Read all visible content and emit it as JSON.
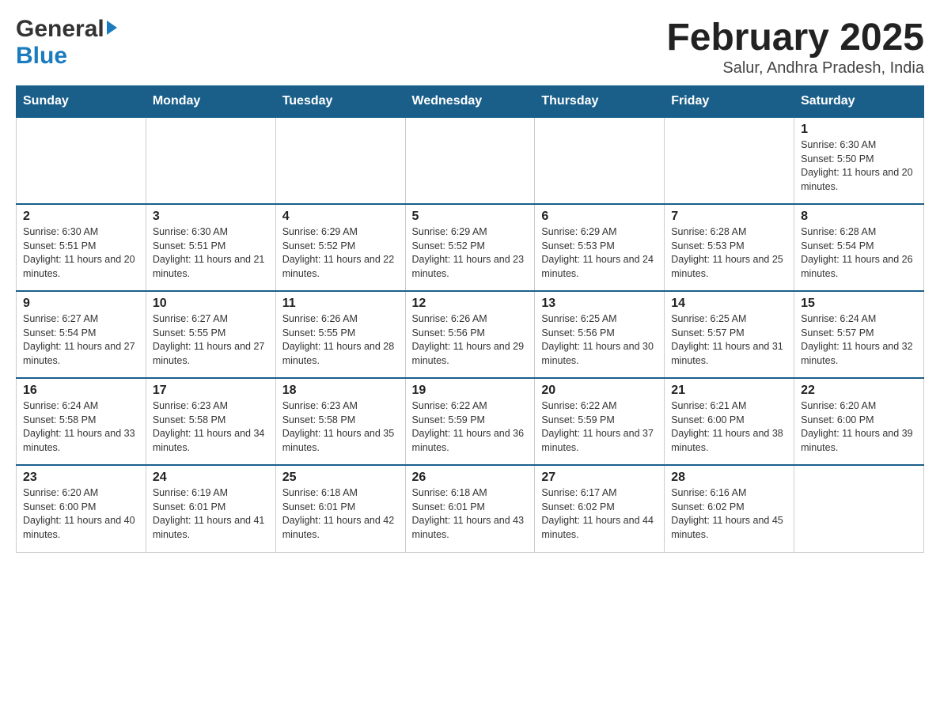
{
  "header": {
    "logo_general": "General",
    "logo_blue": "Blue",
    "month_title": "February 2025",
    "location": "Salur, Andhra Pradesh, India"
  },
  "days_of_week": [
    "Sunday",
    "Monday",
    "Tuesday",
    "Wednesday",
    "Thursday",
    "Friday",
    "Saturday"
  ],
  "weeks": [
    [
      {
        "day": "",
        "info": ""
      },
      {
        "day": "",
        "info": ""
      },
      {
        "day": "",
        "info": ""
      },
      {
        "day": "",
        "info": ""
      },
      {
        "day": "",
        "info": ""
      },
      {
        "day": "",
        "info": ""
      },
      {
        "day": "1",
        "info": "Sunrise: 6:30 AM\nSunset: 5:50 PM\nDaylight: 11 hours and 20 minutes."
      }
    ],
    [
      {
        "day": "2",
        "info": "Sunrise: 6:30 AM\nSunset: 5:51 PM\nDaylight: 11 hours and 20 minutes."
      },
      {
        "day": "3",
        "info": "Sunrise: 6:30 AM\nSunset: 5:51 PM\nDaylight: 11 hours and 21 minutes."
      },
      {
        "day": "4",
        "info": "Sunrise: 6:29 AM\nSunset: 5:52 PM\nDaylight: 11 hours and 22 minutes."
      },
      {
        "day": "5",
        "info": "Sunrise: 6:29 AM\nSunset: 5:52 PM\nDaylight: 11 hours and 23 minutes."
      },
      {
        "day": "6",
        "info": "Sunrise: 6:29 AM\nSunset: 5:53 PM\nDaylight: 11 hours and 24 minutes."
      },
      {
        "day": "7",
        "info": "Sunrise: 6:28 AM\nSunset: 5:53 PM\nDaylight: 11 hours and 25 minutes."
      },
      {
        "day": "8",
        "info": "Sunrise: 6:28 AM\nSunset: 5:54 PM\nDaylight: 11 hours and 26 minutes."
      }
    ],
    [
      {
        "day": "9",
        "info": "Sunrise: 6:27 AM\nSunset: 5:54 PM\nDaylight: 11 hours and 27 minutes."
      },
      {
        "day": "10",
        "info": "Sunrise: 6:27 AM\nSunset: 5:55 PM\nDaylight: 11 hours and 27 minutes."
      },
      {
        "day": "11",
        "info": "Sunrise: 6:26 AM\nSunset: 5:55 PM\nDaylight: 11 hours and 28 minutes."
      },
      {
        "day": "12",
        "info": "Sunrise: 6:26 AM\nSunset: 5:56 PM\nDaylight: 11 hours and 29 minutes."
      },
      {
        "day": "13",
        "info": "Sunrise: 6:25 AM\nSunset: 5:56 PM\nDaylight: 11 hours and 30 minutes."
      },
      {
        "day": "14",
        "info": "Sunrise: 6:25 AM\nSunset: 5:57 PM\nDaylight: 11 hours and 31 minutes."
      },
      {
        "day": "15",
        "info": "Sunrise: 6:24 AM\nSunset: 5:57 PM\nDaylight: 11 hours and 32 minutes."
      }
    ],
    [
      {
        "day": "16",
        "info": "Sunrise: 6:24 AM\nSunset: 5:58 PM\nDaylight: 11 hours and 33 minutes."
      },
      {
        "day": "17",
        "info": "Sunrise: 6:23 AM\nSunset: 5:58 PM\nDaylight: 11 hours and 34 minutes."
      },
      {
        "day": "18",
        "info": "Sunrise: 6:23 AM\nSunset: 5:58 PM\nDaylight: 11 hours and 35 minutes."
      },
      {
        "day": "19",
        "info": "Sunrise: 6:22 AM\nSunset: 5:59 PM\nDaylight: 11 hours and 36 minutes."
      },
      {
        "day": "20",
        "info": "Sunrise: 6:22 AM\nSunset: 5:59 PM\nDaylight: 11 hours and 37 minutes."
      },
      {
        "day": "21",
        "info": "Sunrise: 6:21 AM\nSunset: 6:00 PM\nDaylight: 11 hours and 38 minutes."
      },
      {
        "day": "22",
        "info": "Sunrise: 6:20 AM\nSunset: 6:00 PM\nDaylight: 11 hours and 39 minutes."
      }
    ],
    [
      {
        "day": "23",
        "info": "Sunrise: 6:20 AM\nSunset: 6:00 PM\nDaylight: 11 hours and 40 minutes."
      },
      {
        "day": "24",
        "info": "Sunrise: 6:19 AM\nSunset: 6:01 PM\nDaylight: 11 hours and 41 minutes."
      },
      {
        "day": "25",
        "info": "Sunrise: 6:18 AM\nSunset: 6:01 PM\nDaylight: 11 hours and 42 minutes."
      },
      {
        "day": "26",
        "info": "Sunrise: 6:18 AM\nSunset: 6:01 PM\nDaylight: 11 hours and 43 minutes."
      },
      {
        "day": "27",
        "info": "Sunrise: 6:17 AM\nSunset: 6:02 PM\nDaylight: 11 hours and 44 minutes."
      },
      {
        "day": "28",
        "info": "Sunrise: 6:16 AM\nSunset: 6:02 PM\nDaylight: 11 hours and 45 minutes."
      },
      {
        "day": "",
        "info": ""
      }
    ]
  ]
}
